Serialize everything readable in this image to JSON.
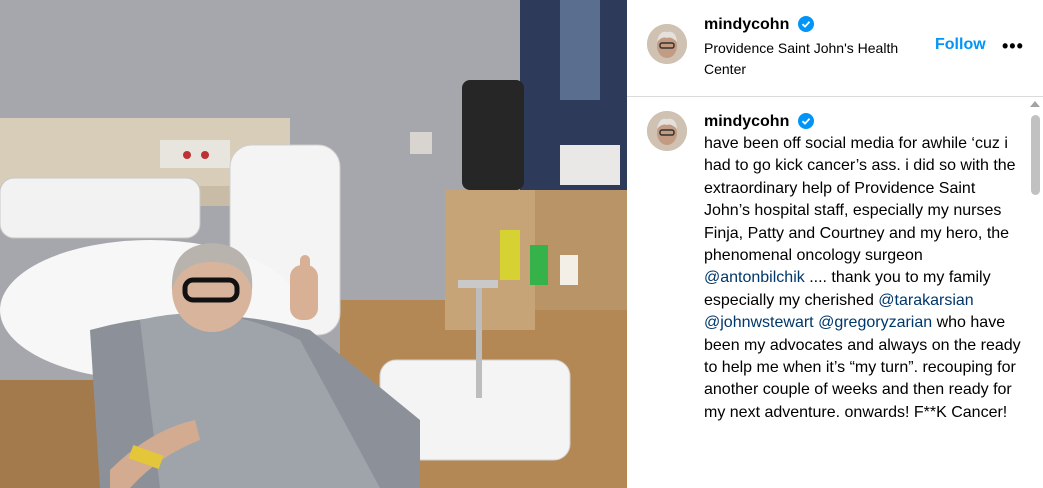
{
  "post": {
    "username": "mindycohn",
    "location": "Providence Saint John's Health Center",
    "follow_label": "Follow",
    "more_label": "•••",
    "caption_parts": {
      "p1": "have been off social media for awhile ‘cuz i had to go kick cancer’s ass.  i did so with the extraordinary help of Providence Saint John’s hospital staff, especially my nurses Finja, Patty and Courtney and my hero, the phenomenal oncology surgeon ",
      "m1": "@antonbilchik",
      "p2": " .... thank you to my family especially my cherished ",
      "m2": "@tarakarsian",
      "p3": " ",
      "m3": "@johnwstewart",
      "p4": " ",
      "m4": "@gregoryzarian",
      "p5": " who have been my advocates and always on the ready to help me when it’s “my turn”. recouping for another couple of weeks and then ready for my next adventure.  onwards! F**K Cancer!"
    }
  },
  "colors": {
    "follow": "#0095f6",
    "verified": "#0095f6",
    "mention": "#00376b"
  },
  "icons": {
    "verified": "verified-badge-icon",
    "scroll_up": "scroll-up-arrow-icon"
  }
}
